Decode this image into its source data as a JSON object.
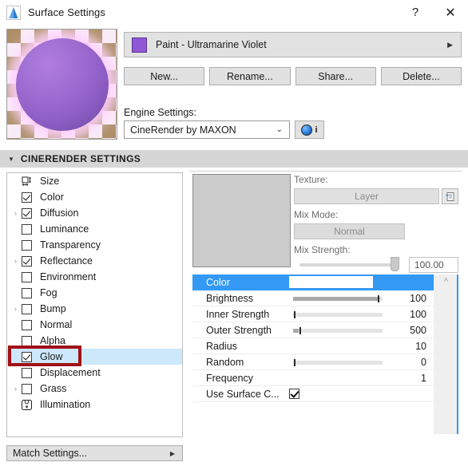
{
  "window": {
    "title": "Surface Settings",
    "icon": "archicad-icon",
    "help_label": "?",
    "close_label": "✕"
  },
  "preview": {
    "name": "surface-preview",
    "sphere_color": "#9f6fd4",
    "glow_color": "#ffc8ff"
  },
  "material": {
    "swatch_color": "#8e58d6",
    "name": "Paint - Ultramarine Violet",
    "arrow": "▶"
  },
  "buttons": {
    "new": "New...",
    "rename": "Rename...",
    "share": "Share...",
    "delete": "Delete..."
  },
  "engine": {
    "label": "Engine Settings:",
    "value": "CineRender by MAXON",
    "chevron": "⌄",
    "info_label": "i"
  },
  "section": {
    "triangle": "▼",
    "title": "CINERENDER SETTINGS"
  },
  "tree": {
    "items": [
      {
        "label": "Size",
        "icon": "size-icon",
        "twisty": "",
        "check": "none",
        "selected": false
      },
      {
        "label": "Color",
        "icon": "checkbox",
        "twisty": "",
        "check": "checked",
        "selected": false
      },
      {
        "label": "Diffusion",
        "icon": "checkbox",
        "twisty": "›",
        "check": "checked",
        "selected": false
      },
      {
        "label": "Luminance",
        "icon": "checkbox",
        "twisty": "",
        "check": "unchecked",
        "selected": false
      },
      {
        "label": "Transparency",
        "icon": "checkbox",
        "twisty": "",
        "check": "unchecked",
        "selected": false
      },
      {
        "label": "Reflectance",
        "icon": "checkbox",
        "twisty": "›",
        "check": "checked",
        "selected": false
      },
      {
        "label": "Environment",
        "icon": "checkbox",
        "twisty": "",
        "check": "unchecked",
        "selected": false
      },
      {
        "label": "Fog",
        "icon": "checkbox",
        "twisty": "",
        "check": "unchecked",
        "selected": false
      },
      {
        "label": "Bump",
        "icon": "checkbox",
        "twisty": "›",
        "check": "unchecked",
        "selected": false
      },
      {
        "label": "Normal",
        "icon": "checkbox",
        "twisty": "",
        "check": "unchecked",
        "selected": false
      },
      {
        "label": "Alpha",
        "icon": "checkbox",
        "twisty": "",
        "check": "unchecked",
        "selected": false
      },
      {
        "label": "Glow",
        "icon": "checkbox",
        "twisty": "",
        "check": "checked",
        "selected": true
      },
      {
        "label": "Displacement",
        "icon": "checkbox",
        "twisty": "",
        "check": "unchecked",
        "selected": false
      },
      {
        "label": "Grass",
        "icon": "checkbox",
        "twisty": "›",
        "check": "unchecked",
        "selected": false
      },
      {
        "label": "Illumination",
        "icon": "illumination-icon",
        "twisty": "",
        "check": "none",
        "selected": false
      }
    ],
    "highlight_color": "#a11016",
    "selection_color": "#cde8fb"
  },
  "match_button": {
    "label": "Match Settings...",
    "arrow": "▶"
  },
  "texture": {
    "label": "Texture:",
    "value": "Layer",
    "button_icon": "texture-browse-icon",
    "mix_mode_label": "Mix Mode:",
    "mix_mode_value": "Normal",
    "mix_strength_label": "Mix Strength:",
    "mix_strength_value": "100.00"
  },
  "properties": {
    "selection_color": "#3399f5",
    "rows": [
      {
        "name": "Color",
        "type": "color",
        "value": "",
        "swatch": "#ffffff",
        "selected": true,
        "slider": null
      },
      {
        "name": "Brightness",
        "type": "slider",
        "value": "100",
        "selected": false,
        "slider": {
          "fill": 95,
          "handle": 95
        }
      },
      {
        "name": "Inner Strength",
        "type": "slider",
        "value": "100",
        "selected": false,
        "slider": {
          "fill": 0,
          "handle": 1
        }
      },
      {
        "name": "Outer Strength",
        "type": "slider",
        "value": "500",
        "selected": false,
        "slider": {
          "fill": 6,
          "handle": 7
        }
      },
      {
        "name": "Radius",
        "type": "value",
        "value": "10",
        "selected": false,
        "slider": null
      },
      {
        "name": "Random",
        "type": "slider",
        "value": "0",
        "selected": false,
        "slider": {
          "fill": 0,
          "handle": 1
        }
      },
      {
        "name": "Frequency",
        "type": "value",
        "value": "1",
        "selected": false,
        "slider": null
      },
      {
        "name": "Use Surface C...",
        "type": "check",
        "value": "",
        "selected": false,
        "slider": null
      }
    ]
  },
  "scrollbar": {
    "up_arrow": "˄"
  }
}
